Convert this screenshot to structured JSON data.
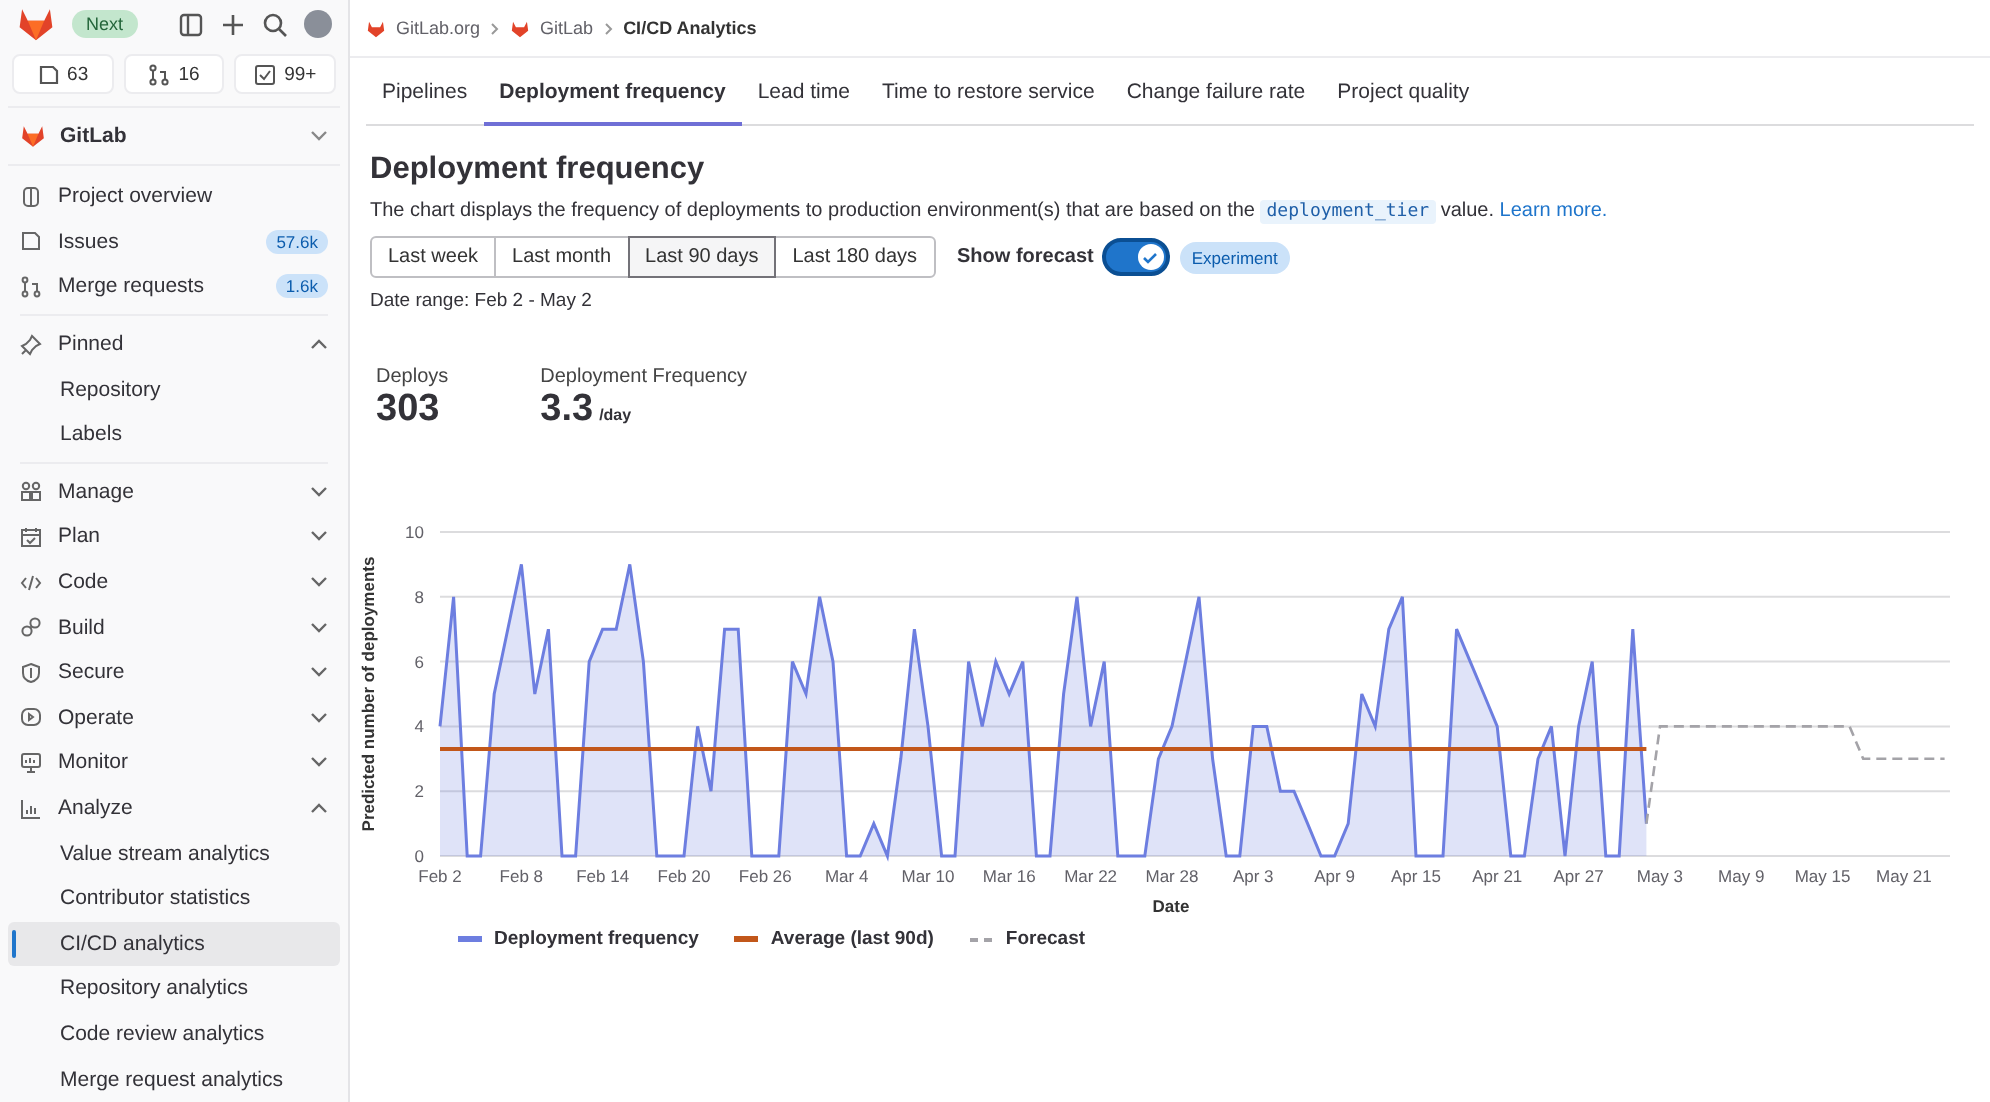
{
  "top_bar": {
    "badge": "Next",
    "counters": [
      {
        "count": "63"
      },
      {
        "count": "16"
      },
      {
        "count": "99+"
      }
    ]
  },
  "project": {
    "name": "GitLab"
  },
  "sidebar": {
    "items": [
      {
        "kind": "item",
        "label": "Project overview",
        "selected": false
      },
      {
        "kind": "item",
        "label": "Issues",
        "badge": "57.6k",
        "selected": false
      },
      {
        "kind": "item",
        "label": "Merge requests",
        "badge": "1.6k",
        "selected": false
      },
      {
        "kind": "divider"
      },
      {
        "kind": "group",
        "label": "Pinned",
        "expanded": true,
        "children": [
          {
            "label": "Repository",
            "selected": false
          },
          {
            "label": "Labels",
            "selected": false
          }
        ]
      },
      {
        "kind": "divider"
      },
      {
        "kind": "group",
        "label": "Manage",
        "expanded": false
      },
      {
        "kind": "group",
        "label": "Plan",
        "expanded": false
      },
      {
        "kind": "group",
        "label": "Code",
        "expanded": false
      },
      {
        "kind": "group",
        "label": "Build",
        "expanded": false
      },
      {
        "kind": "group",
        "label": "Secure",
        "expanded": false
      },
      {
        "kind": "group",
        "label": "Operate",
        "expanded": false
      },
      {
        "kind": "group",
        "label": "Monitor",
        "expanded": false
      },
      {
        "kind": "group",
        "label": "Analyze",
        "expanded": true,
        "children": [
          {
            "label": "Value stream analytics",
            "selected": false
          },
          {
            "label": "Contributor statistics",
            "selected": false
          },
          {
            "label": "CI/CD analytics",
            "selected": true
          },
          {
            "label": "Repository analytics",
            "selected": false
          },
          {
            "label": "Code review analytics",
            "selected": false
          },
          {
            "label": "Merge request analytics",
            "selected": false
          }
        ]
      }
    ]
  },
  "breadcrumb": [
    {
      "label": "GitLab.org",
      "icon": true
    },
    {
      "label": "GitLab",
      "icon": true
    },
    {
      "label": "CI/CD Analytics",
      "icon": false
    }
  ],
  "tabs": [
    {
      "label": "Pipelines",
      "selected": false
    },
    {
      "label": "Deployment frequency",
      "selected": true
    },
    {
      "label": "Lead time",
      "selected": false
    },
    {
      "label": "Time to restore service",
      "selected": false
    },
    {
      "label": "Change failure rate",
      "selected": false
    },
    {
      "label": "Project quality",
      "selected": false
    }
  ],
  "heading": "Deployment frequency",
  "description": {
    "before": "The chart displays the frequency of deployments to production environment(s) that are based on the",
    "code": "deployment_tier",
    "after": "value.",
    "link": "Learn more."
  },
  "ranges": [
    {
      "label": "Last week",
      "selected": false
    },
    {
      "label": "Last month",
      "selected": false
    },
    {
      "label": "Last 90 days",
      "selected": true
    },
    {
      "label": "Last 180 days",
      "selected": false
    }
  ],
  "forecast_toggle": {
    "label": "Show forecast",
    "on": true,
    "badge": "Experiment"
  },
  "date_range": "Date range: Feb 2 - May 2",
  "stats": [
    {
      "label": "Deploys",
      "value": "303"
    },
    {
      "label": "Deployment Frequency",
      "value": "3.3",
      "unit": "/day"
    }
  ],
  "chart": {
    "chart_data": {
      "type": "area",
      "xlabel": "Date",
      "ylabel": "Predicted number of deployments",
      "categories": [
        "Feb 2",
        null,
        null,
        null,
        null,
        null,
        "Feb 8",
        null,
        null,
        null,
        null,
        null,
        "Feb 14",
        null,
        null,
        null,
        null,
        null,
        "Feb 20",
        null,
        null,
        null,
        null,
        null,
        "Feb 26",
        null,
        null,
        null,
        null,
        null,
        "Mar 4",
        null,
        null,
        null,
        null,
        null,
        "Mar 10",
        null,
        null,
        null,
        null,
        null,
        "Mar 16",
        null,
        null,
        null,
        null,
        null,
        "Mar 22",
        null,
        null,
        null,
        null,
        null,
        "Mar 28",
        null,
        null,
        null,
        null,
        null,
        "Apr 3",
        null,
        null,
        null,
        null,
        null,
        "Apr 9",
        null,
        null,
        null,
        null,
        null,
        "Apr 15",
        null,
        null,
        null,
        null,
        null,
        "Apr 21",
        null,
        null,
        null,
        null,
        null,
        "Apr 27",
        null,
        null,
        null,
        null,
        null,
        "May 3",
        null,
        null,
        null,
        null,
        null,
        "May 9",
        null,
        null,
        null,
        null,
        null,
        "May 15",
        null,
        null,
        null,
        null,
        null,
        "May 21",
        null,
        null,
        null
      ],
      "series": [
        {
          "name": "Deployment frequency",
          "color": "#6d7ee0",
          "values": [
            4,
            8,
            0,
            0,
            5,
            7,
            9,
            5,
            7,
            0,
            0,
            6,
            7,
            7,
            9,
            6,
            0,
            0,
            0,
            4,
            2,
            7,
            7,
            0,
            0,
            0,
            6,
            5,
            8,
            6,
            0,
            0,
            1,
            0,
            3,
            7,
            4,
            0,
            0,
            6,
            4,
            6,
            5,
            6,
            0,
            0,
            5,
            8,
            4,
            6,
            0,
            0,
            0,
            3,
            4,
            6,
            8,
            3,
            0,
            0,
            4,
            4,
            2,
            2,
            1,
            0,
            0,
            1,
            5,
            4,
            7,
            8,
            0,
            0,
            0,
            7,
            6,
            5,
            4,
            0,
            0,
            3,
            4,
            0,
            4,
            6,
            0,
            0,
            7,
            1,
            null,
            null,
            null,
            null,
            null,
            null,
            null,
            null,
            null,
            null,
            null,
            null,
            null,
            null,
            null,
            null,
            null,
            null,
            null,
            null,
            null,
            null
          ]
        },
        {
          "name": "Average (last 90d)",
          "color": "#c2571a",
          "type": "line",
          "values": [
            3.3,
            3.3,
            3.3,
            3.3,
            3.3,
            3.3,
            3.3,
            3.3,
            3.3,
            3.3,
            3.3,
            3.3,
            3.3,
            3.3,
            3.3,
            3.3,
            3.3,
            3.3,
            3.3,
            3.3,
            3.3,
            3.3,
            3.3,
            3.3,
            3.3,
            3.3,
            3.3,
            3.3,
            3.3,
            3.3,
            3.3,
            3.3,
            3.3,
            3.3,
            3.3,
            3.3,
            3.3,
            3.3,
            3.3,
            3.3,
            3.3,
            3.3,
            3.3,
            3.3,
            3.3,
            3.3,
            3.3,
            3.3,
            3.3,
            3.3,
            3.3,
            3.3,
            3.3,
            3.3,
            3.3,
            3.3,
            3.3,
            3.3,
            3.3,
            3.3,
            3.3,
            3.3,
            3.3,
            3.3,
            3.3,
            3.3,
            3.3,
            3.3,
            3.3,
            3.3,
            3.3,
            3.3,
            3.3,
            3.3,
            3.3,
            3.3,
            3.3,
            3.3,
            3.3,
            3.3,
            3.3,
            3.3,
            3.3,
            3.3,
            3.3,
            3.3,
            3.3,
            3.3,
            3.3,
            3.3,
            null,
            null,
            null,
            null,
            null,
            null,
            null,
            null,
            null,
            null,
            null,
            null,
            null,
            null,
            null,
            null,
            null,
            null,
            null,
            null,
            null,
            null
          ]
        },
        {
          "name": "Forecast",
          "color": "#a4a3a8",
          "type": "line",
          "line_style": "dashed",
          "values": [
            null,
            null,
            null,
            null,
            null,
            null,
            null,
            null,
            null,
            null,
            null,
            null,
            null,
            null,
            null,
            null,
            null,
            null,
            null,
            null,
            null,
            null,
            null,
            null,
            null,
            null,
            null,
            null,
            null,
            null,
            null,
            null,
            null,
            null,
            null,
            null,
            null,
            null,
            null,
            null,
            null,
            null,
            null,
            null,
            null,
            null,
            null,
            null,
            null,
            null,
            null,
            null,
            null,
            null,
            null,
            null,
            null,
            null,
            null,
            null,
            null,
            null,
            null,
            null,
            null,
            null,
            null,
            null,
            null,
            null,
            null,
            null,
            null,
            null,
            null,
            null,
            null,
            null,
            null,
            null,
            null,
            null,
            null,
            null,
            null,
            null,
            null,
            null,
            null,
            1,
            4,
            4,
            4,
            4,
            4,
            4,
            4,
            4,
            4,
            4,
            4,
            4,
            4,
            4,
            4,
            3,
            3,
            3,
            3,
            3,
            3,
            3
          ]
        }
      ],
      "ylim": [
        0,
        10
      ],
      "yticks": [
        0,
        2,
        4,
        6,
        8,
        10
      ],
      "grid": true
    }
  }
}
